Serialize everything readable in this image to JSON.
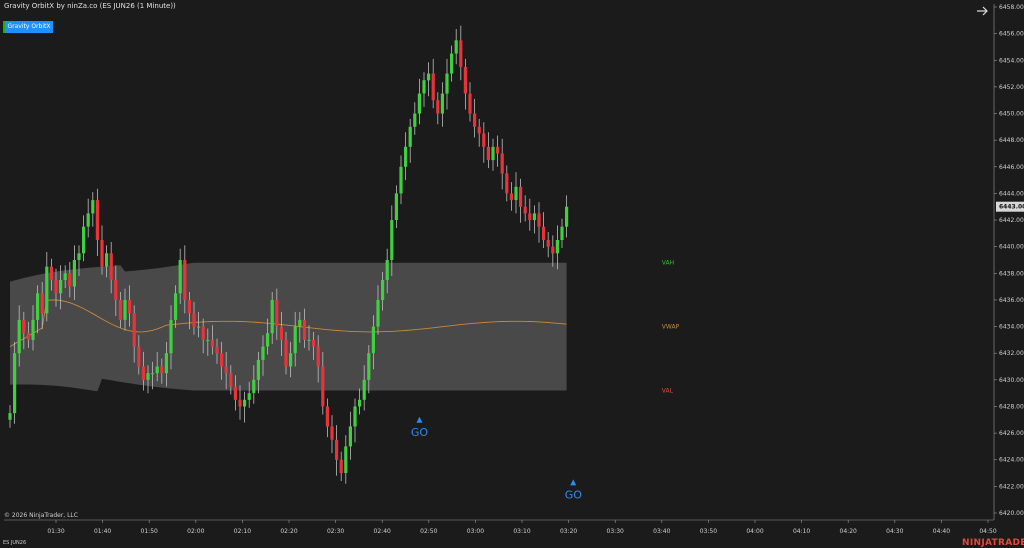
{
  "header": {
    "title": "Gravity OrbitX by ninZa.co (ES JUN26 (1 Minute))",
    "indicator_button": "Gravity OrbitX"
  },
  "footer": {
    "copyright": "© 2026 NinjaTrader, LLC",
    "symbol": "ES JUN26",
    "brand": "NINJATRADER"
  },
  "colors": {
    "background": "#1b1b1b",
    "up_candle": "#3fcf3f",
    "down_candle": "#e8333a",
    "value_area": "#5a5a5a",
    "vwap": "#c8893a",
    "vah": "#2fbf2f",
    "val": "#e8473b",
    "signal": "#2d8cf0",
    "current_price_box": "#d8d8d8"
  },
  "chart_data": {
    "type": "candlestick",
    "symbol": "ES JUN26",
    "interval": "1 Minute",
    "ylim": [
      6420,
      6458
    ],
    "y_ticks": [
      "6420.00",
      "6422.00",
      "6424.00",
      "6426.00",
      "6428.00",
      "6430.00",
      "6432.00",
      "6434.00",
      "6436.00",
      "6438.00",
      "6440.00",
      "6442.00",
      "6444.00",
      "6446.00",
      "6448.00",
      "6450.00",
      "6452.00",
      "6454.00",
      "6456.00",
      "6458.00"
    ],
    "x_ticks": [
      "01:30",
      "01:40",
      "01:50",
      "02:00",
      "02:10",
      "02:20",
      "02:30",
      "02:40",
      "02:50",
      "03:00",
      "03:10",
      "03:20",
      "03:30",
      "03:40",
      "03:50",
      "04:00",
      "04:10",
      "04:20",
      "04:30",
      "04:40",
      "04:50"
    ],
    "current_price": "6443.00",
    "levels": [
      {
        "name": "VAH",
        "value": 6438.8
      },
      {
        "name": "VWAP",
        "value": 6434.0
      },
      {
        "name": "VAL",
        "value": 6429.2
      }
    ],
    "signals": [
      {
        "label": "GO",
        "time": "02:48",
        "price": 6427.0
      },
      {
        "label": "GO",
        "time": "03:21",
        "price": 6422.3
      }
    ],
    "closes": [
      6427.5,
      6432,
      6434.5,
      6433.5,
      6433,
      6434.5,
      6436.5,
      6435,
      6438.5,
      6437.5,
      6436.5,
      6437.5,
      6438,
      6437,
      6439,
      6439.5,
      6441.5,
      6442.5,
      6443.5,
      6440.5,
      6438.5,
      6439.5,
      6437.5,
      6436,
      6434.5,
      6436,
      6435,
      6432.5,
      6431,
      6430,
      6430.5,
      6430.5,
      6431,
      6430.5,
      6432,
      6434.5,
      6436.5,
      6439,
      6436,
      6435,
      6434,
      6434,
      6433,
      6433,
      6432.5,
      6432,
      6431,
      6430.5,
      6429.5,
      6428.5,
      6428,
      6428.5,
      6429,
      6430,
      6431.5,
      6432.5,
      6433.5,
      6436,
      6434,
      6433,
      6431,
      6432,
      6434,
      6434.5,
      6433,
      6433,
      6432.5,
      6431,
      6428,
      6426.5,
      6425.5,
      6424,
      6423,
      6425,
      6426.5,
      6428,
      6428.5,
      6430,
      6432,
      6434,
      6436,
      6437.5,
      6439,
      6442,
      6444,
      6446,
      6447.5,
      6449,
      6450,
      6451.5,
      6452.5,
      6453,
      6451,
      6450,
      6451.5,
      6453,
      6454.5,
      6455.5,
      6453.5,
      6451.5,
      6450,
      6449,
      6448.5,
      6447.5,
      6446.5,
      6447.5,
      6447,
      6445.5,
      6444,
      6443.5,
      6444.5,
      6443,
      6442.5,
      6442,
      6442.5,
      6441.5,
      6440.5,
      6440,
      6439.5,
      6440.5,
      6441.5,
      6443
    ]
  }
}
